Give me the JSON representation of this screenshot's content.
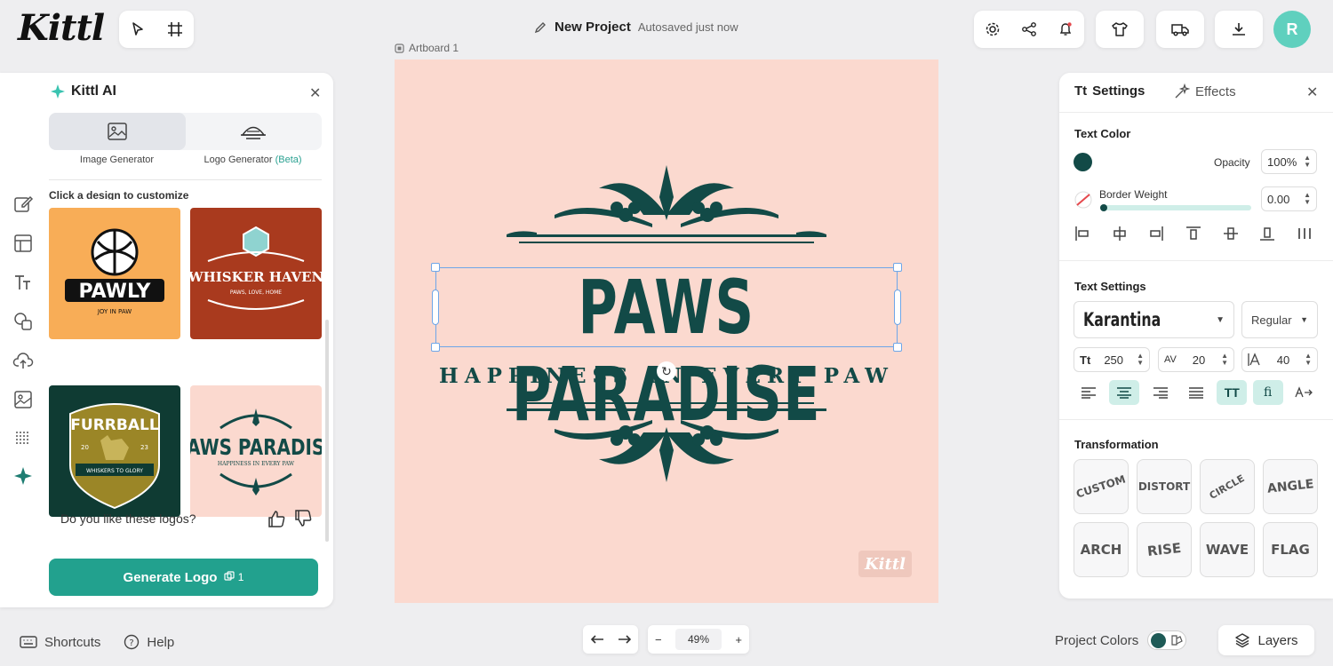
{
  "app": {
    "logo": "Kittl"
  },
  "project": {
    "name": "New Project",
    "status": "Autosaved just now"
  },
  "user": {
    "initial": "R"
  },
  "ai_panel": {
    "title": "Kittl AI",
    "tabs": [
      {
        "label": "Image Generator"
      },
      {
        "label": "Logo Generator",
        "badge": "(Beta)"
      }
    ],
    "hint": "Click a design to customize",
    "designs": [
      {
        "title": "PAWLY",
        "subtitle": "JOY IN PAW",
        "bg": "#f8ad57"
      },
      {
        "title": "WHISKER HAVEN",
        "subtitle": "PAWS, LOVE, HOME",
        "bg": "#a93a1e"
      },
      {
        "title": "FURRBALL",
        "subtitle": "WHISKERS TO GLORY",
        "year_left": "20",
        "year_right": "23",
        "bg": "#0f3b33"
      },
      {
        "title": "PAWS PARADISE",
        "subtitle": "HAPPINESS IN EVERY PAW",
        "bg": "#fbd9cf"
      }
    ],
    "feedback": "Do you like these logos?",
    "generate_label": "Generate Logo",
    "credits": "1"
  },
  "canvas": {
    "artboard_label": "Artboard 1",
    "title": "PAWS PARADISE",
    "subtitle": "HAPPINESS IN EVERY PAW",
    "watermark": "Kittl",
    "bg": "#fbd9cf",
    "ink": "#124a47"
  },
  "settings": {
    "tabs": [
      "Settings",
      "Effects"
    ],
    "text_color_label": "Text Color",
    "text_color": "#124a47",
    "opacity_label": "Opacity",
    "opacity": "100%",
    "border_label": "Border Weight",
    "border_value": "0.00",
    "text_settings_label": "Text Settings",
    "font": "Karantina",
    "weight": "Regular",
    "size": "250",
    "letter_spacing": "20",
    "line_height": "40",
    "case_toggle": "TT",
    "ligature_toggle": "fi",
    "transformation_label": "Transformation",
    "transformations": [
      "CUSTOM",
      "DISTORT",
      "CIRCLE",
      "ANGLE",
      "ARCH",
      "RISE",
      "WAVE",
      "FLAG"
    ]
  },
  "bottom": {
    "shortcuts": "Shortcuts",
    "help": "Help",
    "zoom": "49%",
    "project_colors": "Project Colors",
    "layers": "Layers"
  },
  "colors": {
    "accent": "#22a18e",
    "avatar": "#5fd0be"
  }
}
